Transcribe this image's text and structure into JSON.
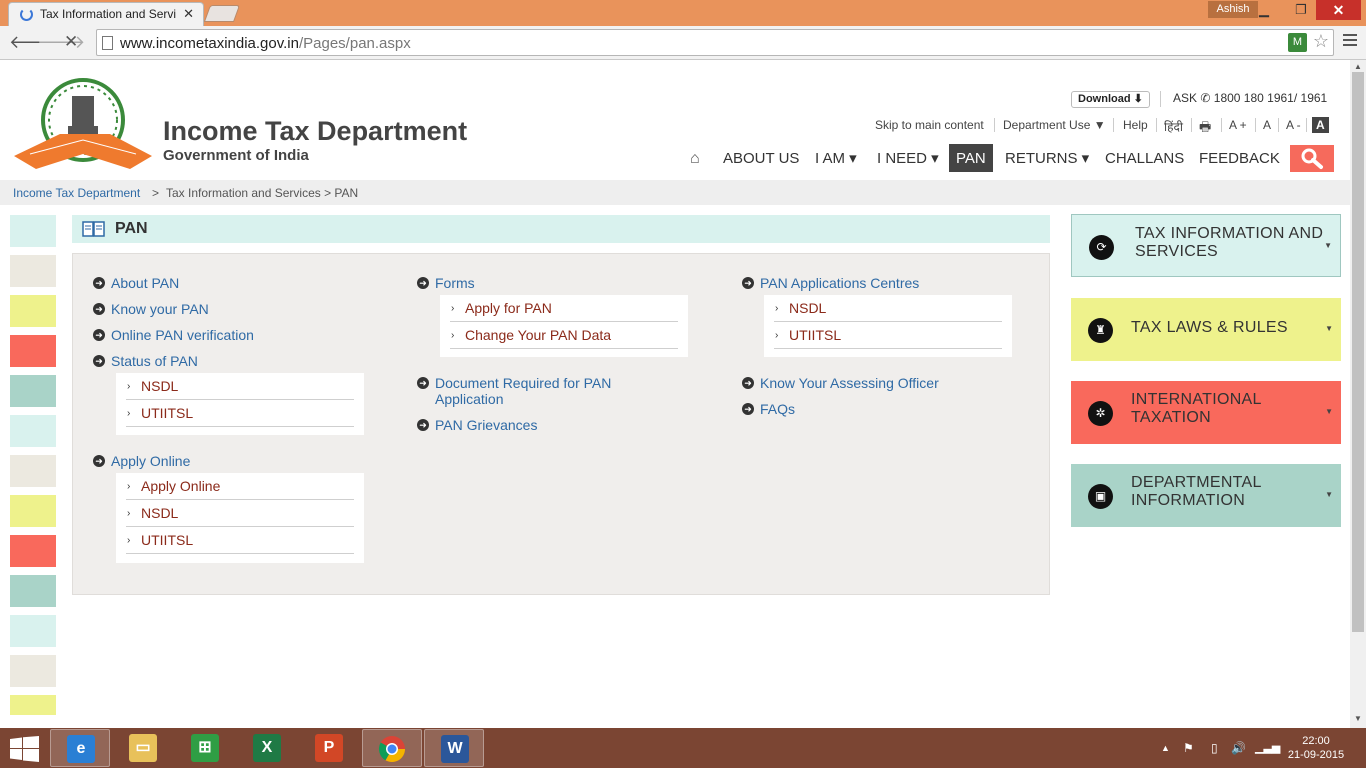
{
  "browser": {
    "tab_title": "Tax Information and Servi",
    "tab_close": "✕",
    "user": "Ashish",
    "url_host": "www.incometaxindia.gov.in",
    "url_path": "/Pages/pan.aspx"
  },
  "header": {
    "title": "Income Tax Department",
    "subtitle": "Government of India",
    "download_label": "Download ⬇",
    "ask_label": "ASK",
    "ask_number": "1800 180 1961/ 1961"
  },
  "utility": {
    "skip": "Skip to main content",
    "department_use": "Department Use ▼",
    "help": "Help",
    "hindi": "हिंदी",
    "font_plus": "A +",
    "font_normal": "A",
    "font_minus": "A -",
    "font_active": "A"
  },
  "nav": {
    "items": [
      {
        "label": "ABOUT US"
      },
      {
        "label": "I AM ▾"
      },
      {
        "label": "I NEED ▾"
      },
      {
        "label": "PAN"
      },
      {
        "label": "RETURNS ▾"
      },
      {
        "label": "CHALLANS"
      },
      {
        "label": "FEEDBACK"
      }
    ]
  },
  "breadcrumb": {
    "home": "Income Tax Department",
    "sep": ">",
    "rest": "Tax Information and Services > PAN"
  },
  "section": {
    "title": "PAN"
  },
  "col1": {
    "about": "About PAN",
    "know": "Know your PAN",
    "verify": "Online PAN verification",
    "status": "Status of PAN",
    "status_sub": [
      "NSDL",
      "UTIITSL"
    ],
    "apply": "Apply Online",
    "apply_sub": [
      "Apply Online",
      "NSDL",
      "UTIITSL"
    ]
  },
  "col2": {
    "forms": "Forms",
    "forms_sub": [
      "Apply for PAN",
      "Change Your PAN Data"
    ],
    "docs": "Document Required for PAN Application",
    "grievances": "PAN Grievances"
  },
  "col3": {
    "centres": "PAN Applications Centres",
    "centres_sub": [
      "NSDL",
      "UTIITSL"
    ],
    "officer": "Know Your Assessing Officer",
    "faqs": "FAQs"
  },
  "sidebar": {
    "boxes": [
      {
        "label": "TAX INFORMATION AND SERVICES",
        "color": "#d9f2ee"
      },
      {
        "label": "TAX LAWS & RULES",
        "color": "#eef28c"
      },
      {
        "label": "INTERNATIONAL TAXATION",
        "color": "#f9695c"
      },
      {
        "label": "DEPARTMENTAL INFORMATION",
        "color": "#a9d3c8"
      }
    ]
  },
  "swatches": [
    "#d9f2ee",
    "#ece9e0",
    "#eef28c",
    "#f9695c",
    "#a9d3c8",
    "#d9f2ee",
    "#ece9e0",
    "#eef28c",
    "#f9695c",
    "#a9d3c8",
    "#d9f2ee",
    "#ece9e0",
    "#eef28c"
  ],
  "taskbar": {
    "time": "22:00",
    "date": "21-09-2015"
  }
}
